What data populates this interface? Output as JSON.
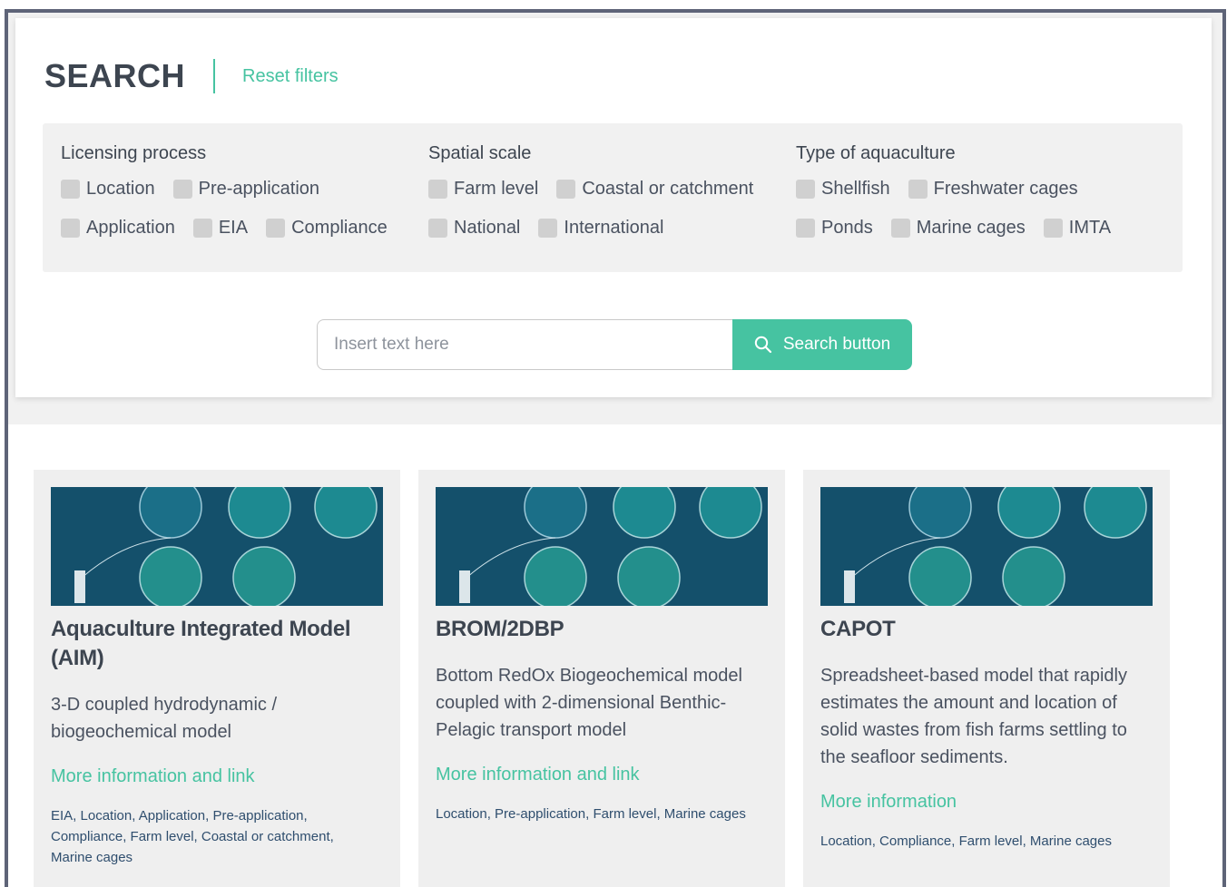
{
  "header": {
    "title": "SEARCH",
    "reset_label": "Reset filters"
  },
  "filters": {
    "licensing": {
      "title": "Licensing process",
      "options": [
        "Location",
        "Pre-application",
        "Application",
        "EIA",
        "Compliance"
      ]
    },
    "spatial": {
      "title": "Spatial scale",
      "options": [
        "Farm level",
        "Coastal or catchment",
        "National",
        "International"
      ]
    },
    "aquaculture": {
      "title": "Type of aquaculture",
      "options": [
        "Shellfish",
        "Freshwater cages",
        "Ponds",
        "Marine cages",
        "IMTA"
      ]
    }
  },
  "search": {
    "placeholder": "Insert text here",
    "button_label": "Search button"
  },
  "cards": [
    {
      "title": "Aquaculture Integrated Model (AIM)",
      "description": "3-D coupled hydrodynamic / biogeochemical model",
      "link": "More information and link",
      "tags": "EIA, Location, Application, Pre-application, Compliance, Farm level, Coastal or catchment, Marine cages"
    },
    {
      "title": "BROM/2DBP",
      "description": "Bottom RedOx Biogeochemical model coupled with 2-dimensional Benthic-Pelagic transport model",
      "link": "More information and link",
      "tags": "Location, Pre-application, Farm level, Marine cages"
    },
    {
      "title": "CAPOT",
      "description": "Spreadsheet-based model that rapidly estimates the amount and location of solid wastes from fish farms settling to the seafloor sediments.",
      "link": "More information",
      "tags": "Location, Compliance, Farm level, Marine cages"
    }
  ],
  "colors": {
    "accent": "#46c3a1",
    "text": "#3d4550",
    "tag": "#2f4e6e",
    "panel_bg": "#f1f1f1",
    "checkbox": "#d0d0d0"
  }
}
